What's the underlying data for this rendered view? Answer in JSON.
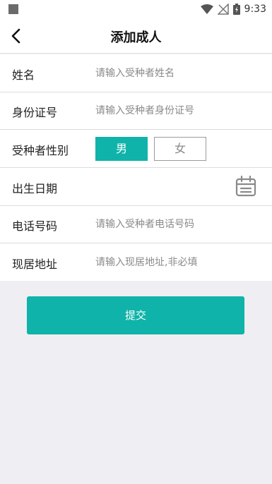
{
  "status_bar": {
    "time": "9:33"
  },
  "header": {
    "title": "添加成人",
    "back_icon": "chevron-left-icon"
  },
  "form": {
    "name": {
      "label": "姓名",
      "placeholder": "请输入受种者姓名"
    },
    "id_number": {
      "label": "身份证号",
      "placeholder": "请输入受种者身份证号"
    },
    "gender": {
      "label": "受种者性别",
      "male": "男",
      "female": "女",
      "selected": "男"
    },
    "birth_date": {
      "label": "出生日期",
      "icon": "calendar-icon"
    },
    "phone": {
      "label": "电话号码",
      "placeholder": "请输入受种者电话号码"
    },
    "address": {
      "label": "现居地址",
      "placeholder": "请输入现居地址,非必填"
    }
  },
  "submit": {
    "label": "提交"
  },
  "colors": {
    "accent": "#0fb3a9",
    "background": "#efeef3"
  }
}
